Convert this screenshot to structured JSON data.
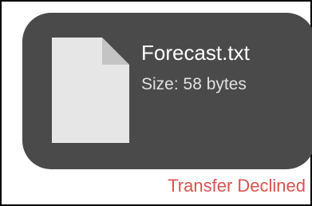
{
  "file": {
    "name": "Forecast.txt",
    "size_text": "Size: 58 bytes",
    "icon": "document-icon"
  },
  "status": {
    "text": "Transfer Declined",
    "color": "#d9534f"
  },
  "colors": {
    "card_background": "#4a4a4a",
    "file_icon_body": "#e6e6e6",
    "file_icon_fold": "#c4c4c4"
  }
}
